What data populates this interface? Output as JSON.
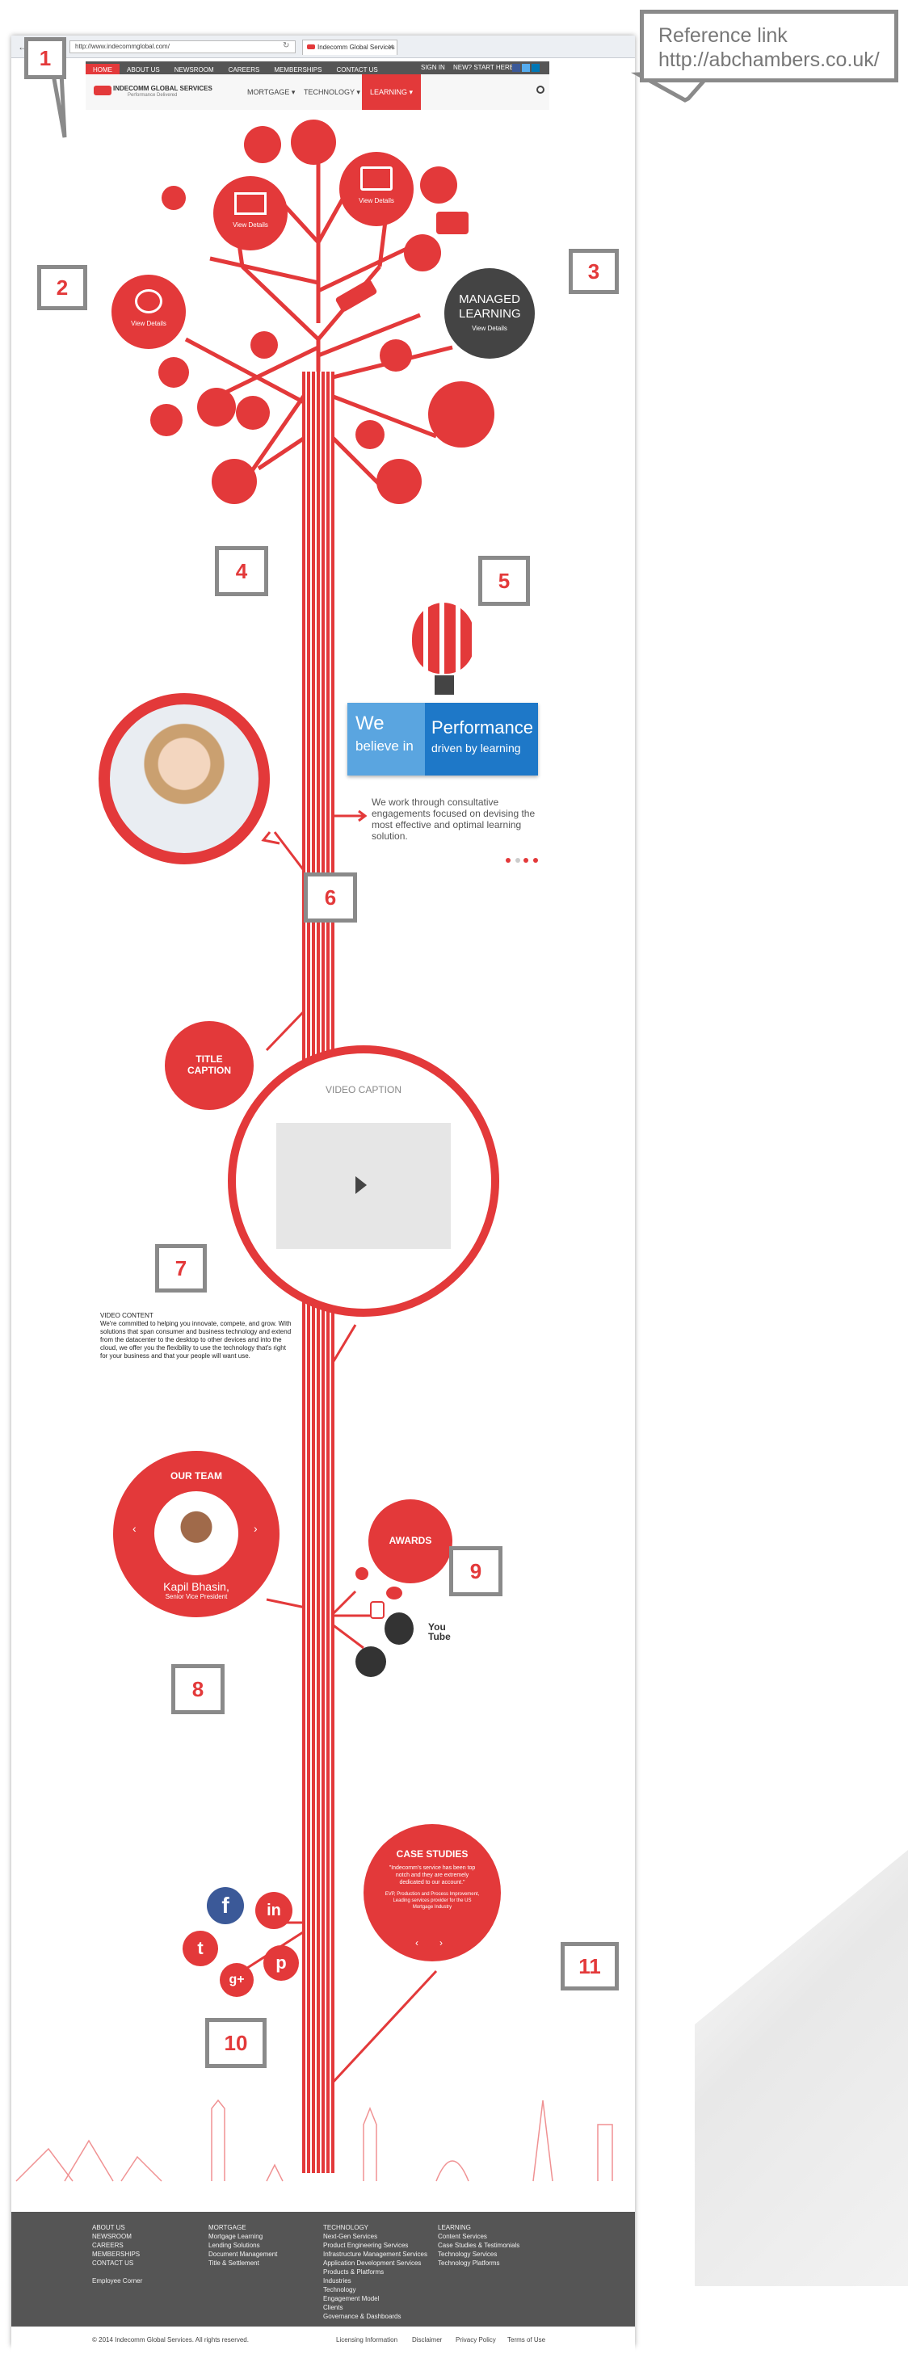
{
  "browser": {
    "url": "http://www.indecommglobal.com/",
    "tab_title": "Indecomm Global Services"
  },
  "top_nav": [
    "HOME",
    "ABOUT US",
    "NEWSROOM",
    "CAREERS",
    "MEMBERSHIPS",
    "CONTACT US"
  ],
  "top_nav_right": [
    "SIGN IN",
    "NEW? START HERE"
  ],
  "main_nav": {
    "mortgage": "MORTGAGE ▾",
    "technology": "TECHNOLOGY ▾",
    "learning": "LEARNING ▾"
  },
  "logo": {
    "name": "INDECOMM GLOBAL SERVICES",
    "tagline": "Performance Delivered"
  },
  "reference": {
    "label": "Reference link",
    "url": "http://abchambers.co.uk/"
  },
  "callouts": [
    "1",
    "2",
    "3",
    "4",
    "5",
    "6",
    "7",
    "8",
    "9",
    "10",
    "11"
  ],
  "tree": {
    "view_details": "View Details",
    "managed_learning_title": "MANAGED LEARNING",
    "managed_learning_link": "View Details"
  },
  "banner": {
    "we": "We",
    "believe_in": "believe in",
    "performance": "Performance",
    "driven_by": "driven by learning"
  },
  "intro_text": "We work through consultative engagements focused on devising the most effective and optimal learning solution.",
  "title_caption": "TITLE CAPTION",
  "video": {
    "caption": "VIDEO CAPTION",
    "content_heading": "VIDEO CONTENT",
    "content_text": "We're committed to helping you innovate, compete, and grow. With solutions that span consumer and business technology and extend from the datacenter to the desktop to other devices and into the cloud, we offer you the flexibility to use the technology that's right for your business and that your people will want use."
  },
  "team": {
    "title": "OUR TEAM",
    "name": "Kapil Bhasin,",
    "role": "Senior Vice President",
    "prev": "‹",
    "next": "›"
  },
  "awards": {
    "title": "AWARDS"
  },
  "case_studies": {
    "title": "CASE STUDIES",
    "quote": "\"Indecomm's service has been top notch and they are extremely dedicated to our account.\"",
    "attribution": "EVP, Production and Process Improvement, Leading services provider for the US Mortgage Industry",
    "prev": "‹",
    "next": "›"
  },
  "social": {
    "facebook": "f",
    "linkedin": "in",
    "twitter": "t",
    "pinterest": "p",
    "google": "g+"
  },
  "brand_icons": {
    "youtube": "You Tube"
  },
  "footer": {
    "cols": [
      {
        "items": [
          "ABOUT US",
          "NEWSROOM",
          "CAREERS",
          "MEMBERSHIPS",
          "CONTACT US",
          "",
          "Employee Corner"
        ]
      },
      {
        "items": [
          "MORTGAGE",
          "Mortgage Learning",
          "Lending Solutions",
          "Document Management",
          "Title & Settlement"
        ]
      },
      {
        "items": [
          "TECHNOLOGY",
          "Next-Gen Services",
          "Product Engineering Services",
          "Infrastructure Management Services",
          "Application Development Services",
          "Products & Platforms",
          "Industries",
          "Technology",
          "Engagement Model",
          "Clients",
          "Governance & Dashboards"
        ]
      },
      {
        "items": [
          "LEARNING",
          "Content Services",
          "Case Studies & Testimonials",
          "Technology Services",
          "Technology Platforms"
        ]
      }
    ],
    "copyright": "© 2014 Indecomm Global Services. All rights reserved.",
    "links": [
      "Licensing Information",
      "Disclaimer",
      "Privacy Policy",
      "Terms of Use"
    ]
  },
  "colors": {
    "accent": "#e3393a",
    "dark": "#555555",
    "callout_border": "#8a8a8a",
    "banner_blue": "#1e78c8"
  }
}
